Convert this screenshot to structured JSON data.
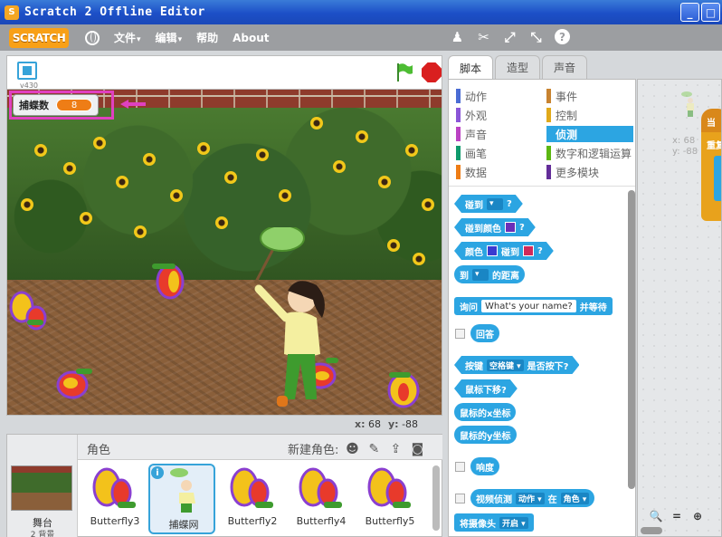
{
  "window": {
    "title": "Scratch 2 Offline Editor",
    "controls": [
      "_",
      "□"
    ]
  },
  "menubar": {
    "logo": "SCRATCH",
    "items": [
      {
        "label": "文件",
        "caret": "▾"
      },
      {
        "label": "编辑",
        "caret": "▾"
      },
      {
        "label": "帮助",
        "caret": ""
      },
      {
        "label": "About",
        "caret": ""
      }
    ],
    "tools": [
      "duplicate-icon",
      "cut-icon",
      "grow-icon",
      "shrink-icon",
      "help-icon"
    ]
  },
  "stage": {
    "version": "v430",
    "variable": {
      "label": "捕蝶数",
      "value": "8"
    },
    "x_label": "x:",
    "x_value": "68",
    "y_label": "y:",
    "y_value": "-88"
  },
  "sprite_pane": {
    "title": "角色",
    "new_sprite_label": "新建角色:",
    "stage_label": "舞台",
    "stage_backdrops": "2 背景",
    "sprites": [
      {
        "name": "Butterfly3",
        "selected": false
      },
      {
        "name": "捕蝶网",
        "selected": true
      },
      {
        "name": "Butterfly2",
        "selected": false
      },
      {
        "name": "Butterfly4",
        "selected": false
      },
      {
        "name": "Butterfly5",
        "selected": false
      }
    ]
  },
  "tabs": [
    {
      "label": "脚本",
      "active": true
    },
    {
      "label": "造型",
      "active": false
    },
    {
      "label": "声音",
      "active": false
    }
  ],
  "categories": [
    {
      "label": "动作",
      "color": "#4a6cd4"
    },
    {
      "label": "外观",
      "color": "#8a55d7"
    },
    {
      "label": "声音",
      "color": "#bb42c3"
    },
    {
      "label": "画笔",
      "color": "#0e9a6c"
    },
    {
      "label": "数据",
      "color": "#ee7d16"
    },
    {
      "label": "事件",
      "color": "#c88330"
    },
    {
      "label": "控制",
      "color": "#e1a91a"
    },
    {
      "label": "侦测",
      "color": "#2ca5e2",
      "active": true
    },
    {
      "label": "数字和逻辑运算",
      "color": "#5cb712"
    },
    {
      "label": "更多模块",
      "color": "#632d99"
    }
  ],
  "blocks": {
    "touching": {
      "text": "碰到",
      "slot": "▾",
      "tail": "?"
    },
    "touching_color": {
      "text": "碰到颜色",
      "tail": "?"
    },
    "color_touching": {
      "text1": "颜色",
      "text2": "碰到",
      "tail": "?"
    },
    "distance": {
      "text1": "到",
      "slot": "▾",
      "text2": "的距离"
    },
    "ask": {
      "text1": "询问",
      "input": "What's your name?",
      "text2": "并等待"
    },
    "answer": {
      "text": "回答"
    },
    "key_pressed": {
      "text1": "按键",
      "slot": "空格键 ▾",
      "text2": "是否按下?"
    },
    "mouse_down": {
      "text": "鼠标下移?"
    },
    "mouse_x": {
      "text": "鼠标的x坐标"
    },
    "mouse_y": {
      "text": "鼠标的y坐标"
    },
    "loudness": {
      "text": "响度"
    },
    "video_sense": {
      "text1": "视频侦测",
      "slot1": "动作 ▾",
      "text2": "在",
      "slot2": "角色 ▾"
    },
    "turn_video": {
      "text1": "将摄像头",
      "slot": "开启 ▾"
    }
  },
  "script_area": {
    "x_label": "x: 68",
    "y_label": "y: -88",
    "event_text": "当",
    "control_text": "重复",
    "zoom": [
      "zoom-out-icon",
      "zoom-reset-icon",
      "zoom-in-icon"
    ]
  }
}
